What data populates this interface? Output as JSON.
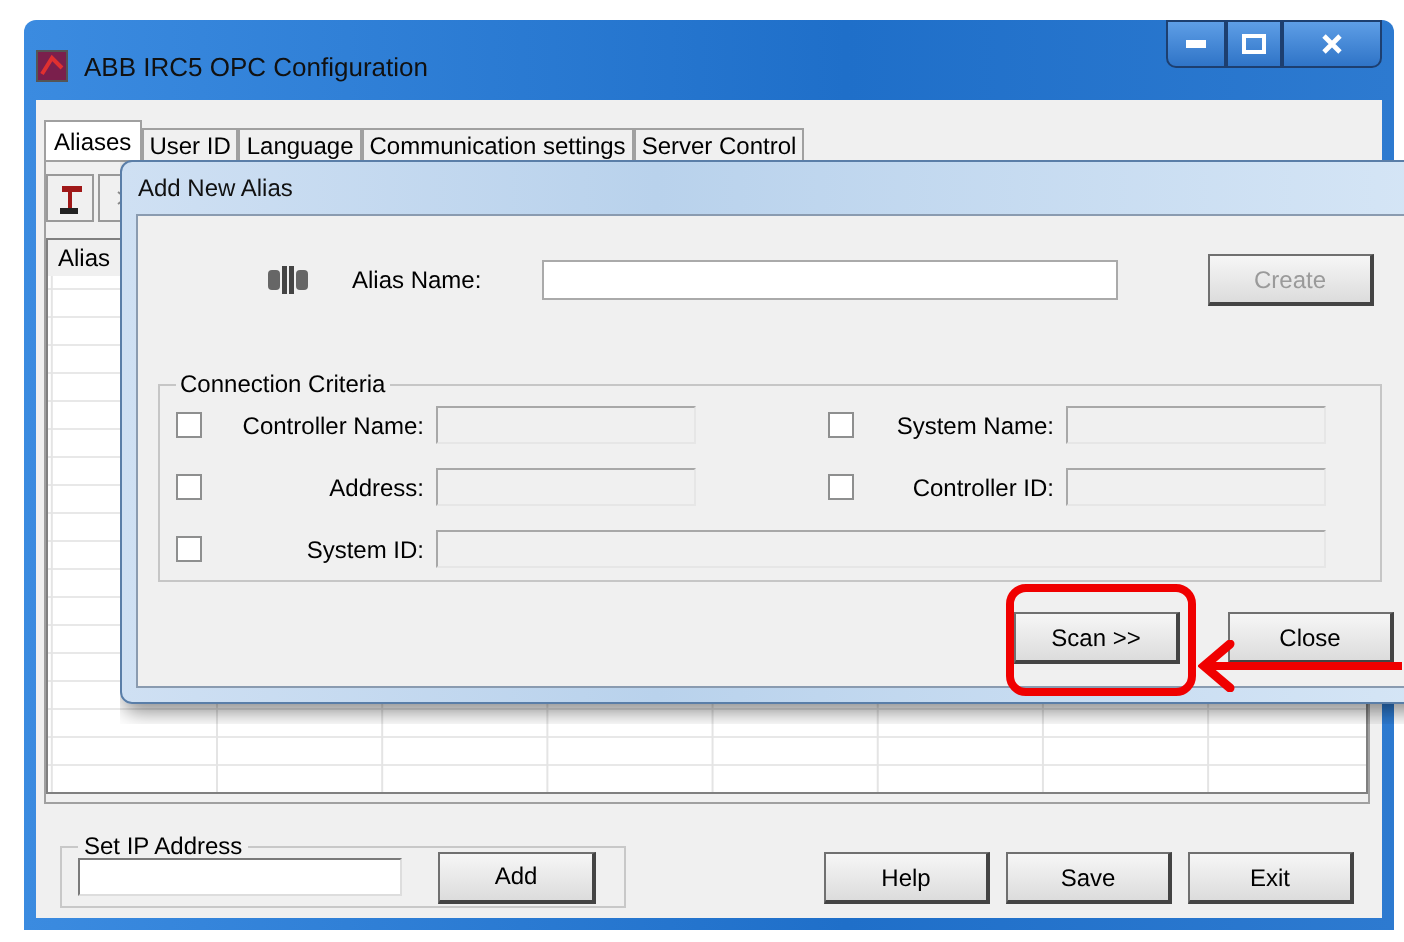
{
  "window": {
    "title": "ABB IRC5 OPC Configuration"
  },
  "tabs": [
    {
      "label": "Aliases",
      "selected": true
    },
    {
      "label": "User ID",
      "selected": false
    },
    {
      "label": "Language",
      "selected": false
    },
    {
      "label": "Communication settings",
      "selected": false
    },
    {
      "label": "Server Control",
      "selected": false
    }
  ],
  "table": {
    "columns": [
      "Alias"
    ]
  },
  "ip_group": {
    "title": "Set IP Address",
    "button": "Add"
  },
  "buttons": [
    "Help",
    "Save",
    "Exit"
  ],
  "dialog": {
    "title": "Add New Alias",
    "alias_label": "Alias Name:",
    "create_button": {
      "label": "Create",
      "disabled": true
    },
    "criteria": {
      "title": "Connection Criteria",
      "fields": [
        {
          "label": "Controller Name:",
          "checked": false,
          "kind": "half"
        },
        {
          "label": "System Name:",
          "checked": false,
          "kind": "half"
        },
        {
          "label": "Address:",
          "checked": false,
          "kind": "half"
        },
        {
          "label": "Controller ID:",
          "checked": false,
          "kind": "half"
        },
        {
          "label": "System ID:",
          "checked": false,
          "kind": "wide"
        }
      ]
    },
    "buttons": [
      {
        "label": "Scan >>",
        "highlighted": true
      },
      {
        "label": "Close",
        "highlighted": false
      }
    ]
  }
}
